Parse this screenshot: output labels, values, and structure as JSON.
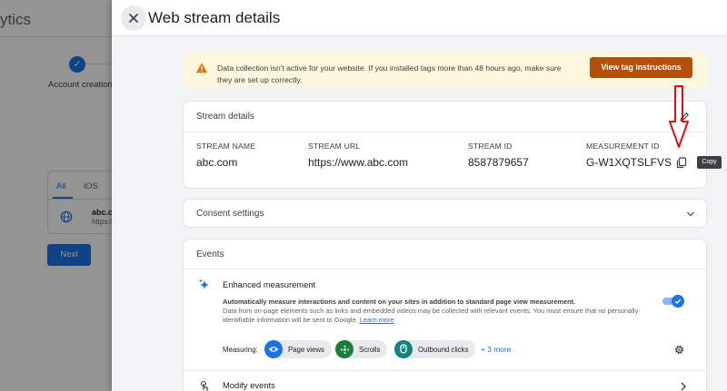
{
  "background": {
    "title_fragment": "ytics",
    "step_label": "Account creation",
    "tabs": [
      "All",
      "iOS"
    ],
    "stream_name_fragment": "abc.c",
    "stream_url_fragment": "https:/",
    "next_label": "Next"
  },
  "drawer": {
    "title": "Web stream details",
    "warning": {
      "text": "Data collection isn't active for your website. If you installed tags more than 48 hours ago, make sure they are set up correctly.",
      "button_label": "View tag instructions"
    },
    "stream_details": {
      "heading": "Stream details",
      "fields": [
        {
          "label": "STREAM NAME",
          "value": "abc.com"
        },
        {
          "label": "STREAM URL",
          "value": "https://www.abc.com"
        },
        {
          "label": "STREAM ID",
          "value": "8587879657"
        },
        {
          "label": "MEASUREMENT ID",
          "value": "G-W1XQTSLFVS"
        }
      ],
      "copy_tooltip": "Copy"
    },
    "consent": {
      "heading": "Consent settings"
    },
    "events": {
      "heading": "Events",
      "enhanced_measurement": {
        "title": "Enhanced measurement",
        "description_bold": "Automatically measure interactions and content on your sites in addition to standard page view measurement.",
        "description": "Data from on-page elements such as links and embedded videos may be collected with relevant events. You must ensure that no personally-identifiable information will be sent to Google.",
        "learn_more": "Learn more",
        "enabled": true
      },
      "measuring_label": "Measuring:",
      "chips": [
        {
          "label": "Page views",
          "icon": "eye-icon",
          "color": "#1a73e8"
        },
        {
          "label": "Scrolls",
          "icon": "crosshair-icon",
          "color": "#188038"
        },
        {
          "label": "Outbound clicks",
          "icon": "pointer-icon",
          "color": "#12837e"
        }
      ],
      "more_label": "+ 3 more",
      "modify_events_label": "Modify events"
    }
  },
  "colors": {
    "accent": "#1a73e8",
    "warning_button": "#b5500b",
    "warning_bg": "#fef7e0",
    "annotation": "#e01010"
  }
}
